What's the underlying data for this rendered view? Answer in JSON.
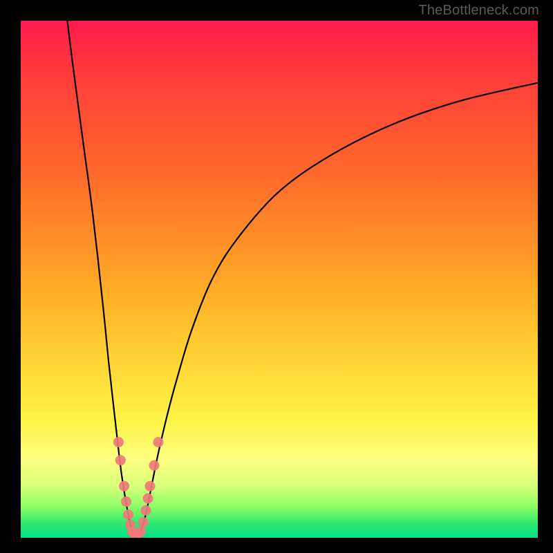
{
  "watermark": "TheBottleneck.com",
  "chart_data": {
    "type": "line",
    "title": "",
    "xlabel": "",
    "ylabel": "",
    "xlim": [
      0,
      100
    ],
    "ylim": [
      0,
      100
    ],
    "series": [
      {
        "name": "left-branch",
        "x": [
          9,
          10,
          12,
          14,
          16,
          17,
          18,
          18.8,
          19.4,
          20,
          20.6,
          21.1,
          21.6
        ],
        "y": [
          100,
          92,
          77,
          62,
          44,
          34,
          25,
          18,
          13,
          9,
          5.5,
          3,
          1.2
        ]
      },
      {
        "name": "right-branch",
        "x": [
          23.2,
          23.8,
          24.5,
          25.3,
          26.2,
          27.2,
          28.4,
          30,
          33,
          37,
          42,
          50,
          60,
          72,
          85,
          100
        ],
        "y": [
          1.2,
          3,
          6,
          10,
          14.5,
          19,
          24,
          30,
          40,
          50,
          58,
          67,
          74,
          80,
          84.5,
          88
        ]
      }
    ],
    "flat_segment": {
      "x": [
        21.6,
        23.2
      ],
      "y": 0.6
    },
    "points": {
      "name": "data-points",
      "color": "#ef7a7a",
      "xy": [
        [
          18.9,
          18.5
        ],
        [
          19.3,
          15.0
        ],
        [
          20.0,
          10.0
        ],
        [
          20.4,
          7.0
        ],
        [
          20.8,
          4.5
        ],
        [
          21.2,
          2.5
        ],
        [
          21.6,
          1.2
        ],
        [
          22.0,
          0.6
        ],
        [
          22.6,
          0.6
        ],
        [
          23.2,
          1.2
        ],
        [
          23.7,
          3.0
        ],
        [
          24.2,
          5.3
        ],
        [
          24.6,
          7.6
        ],
        [
          25.0,
          10.0
        ],
        [
          25.8,
          14.0
        ],
        [
          26.6,
          18.5
        ]
      ]
    },
    "gradient_stops": [
      {
        "pos": 0,
        "color": "#ff1a4d"
      },
      {
        "pos": 30,
        "color": "#ff6a2a"
      },
      {
        "pos": 65,
        "color": "#ffd233"
      },
      {
        "pos": 85,
        "color": "#fdff80"
      },
      {
        "pos": 100,
        "color": "#00e08a"
      }
    ]
  }
}
